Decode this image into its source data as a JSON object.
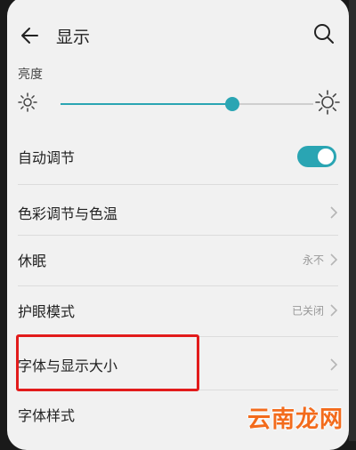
{
  "header": {
    "title": "显示"
  },
  "brightness": {
    "label": "亮度",
    "level_percent": 68
  },
  "auto_adjust": {
    "label": "自动调节",
    "enabled": true
  },
  "rows": [
    {
      "label": "色彩调节与色温",
      "value": ""
    },
    {
      "label": "休眠",
      "value": "永不"
    },
    {
      "label": "护眼模式",
      "value": "已关闭"
    },
    {
      "label": "字体与显示大小",
      "value": ""
    },
    {
      "label": "字体样式",
      "value": ""
    }
  ],
  "watermark": "云南龙网",
  "colors": {
    "accent": "#2aa5b3",
    "highlight": "#e21b1b",
    "watermark": "#f36b1c"
  },
  "icons": {
    "back": "arrow-left-icon",
    "search": "search-icon",
    "sun_small": "sun-icon",
    "sun_large": "sun-icon",
    "chevron": "chevron-right-icon"
  }
}
